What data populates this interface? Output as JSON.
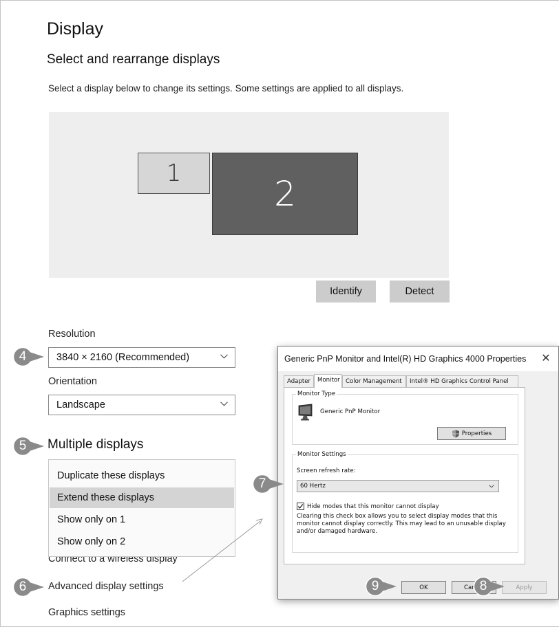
{
  "settings": {
    "title": "Display",
    "section_title": "Select and rearrange displays",
    "hint": "Select a display below to change its settings. Some settings are applied to all displays.",
    "monitors": [
      "1",
      "2"
    ],
    "identify_label": "Identify",
    "detect_label": "Detect",
    "resolution_label": "Resolution",
    "resolution_value": "3840 × 2160 (Recommended)",
    "orientation_label": "Orientation",
    "orientation_value": "Landscape",
    "multiple_displays_title": "Multiple displays",
    "multiple_displays_options": [
      {
        "label": "Duplicate these displays",
        "selected": false
      },
      {
        "label": "Extend these displays",
        "selected": true
      },
      {
        "label": "Show only on 1",
        "selected": false
      },
      {
        "label": "Show only on 2",
        "selected": false
      }
    ],
    "connect_wireless": "Connect to a wireless display",
    "advanced_settings": "Advanced display settings",
    "graphics_settings": "Graphics settings"
  },
  "callouts": [
    "4",
    "5",
    "6",
    "7",
    "8",
    "9"
  ],
  "dialog": {
    "title": "Generic PnP Monitor and Intel(R) HD Graphics 4000 Properties",
    "close_glyph": "✕",
    "tabs": [
      {
        "label": "Adapter",
        "active": false
      },
      {
        "label": "Monitor",
        "active": true
      },
      {
        "label": "Color Management",
        "active": false
      },
      {
        "label": "Intel® HD Graphics Control Panel",
        "active": false
      }
    ],
    "monitor_type_label": "Monitor Type",
    "monitor_name": "Generic PnP Monitor",
    "properties_button": "Properties",
    "monitor_settings_label": "Monitor Settings",
    "refresh_rate_label": "Screen refresh rate:",
    "refresh_rate_value": "60 Hertz",
    "hide_modes_label": "Hide modes that this monitor cannot display",
    "hide_modes_checked": true,
    "description": "Clearing this check box allows you to select display modes that this monitor cannot display correctly. This may lead to an unusable display and/or damaged hardware.",
    "ok_label": "OK",
    "cancel_label": "Cancel",
    "apply_label": "Apply"
  },
  "colors": {
    "callout": "#8a8a8a",
    "monitor_selected": "#606060",
    "selected_option": "#d4d4d4"
  }
}
